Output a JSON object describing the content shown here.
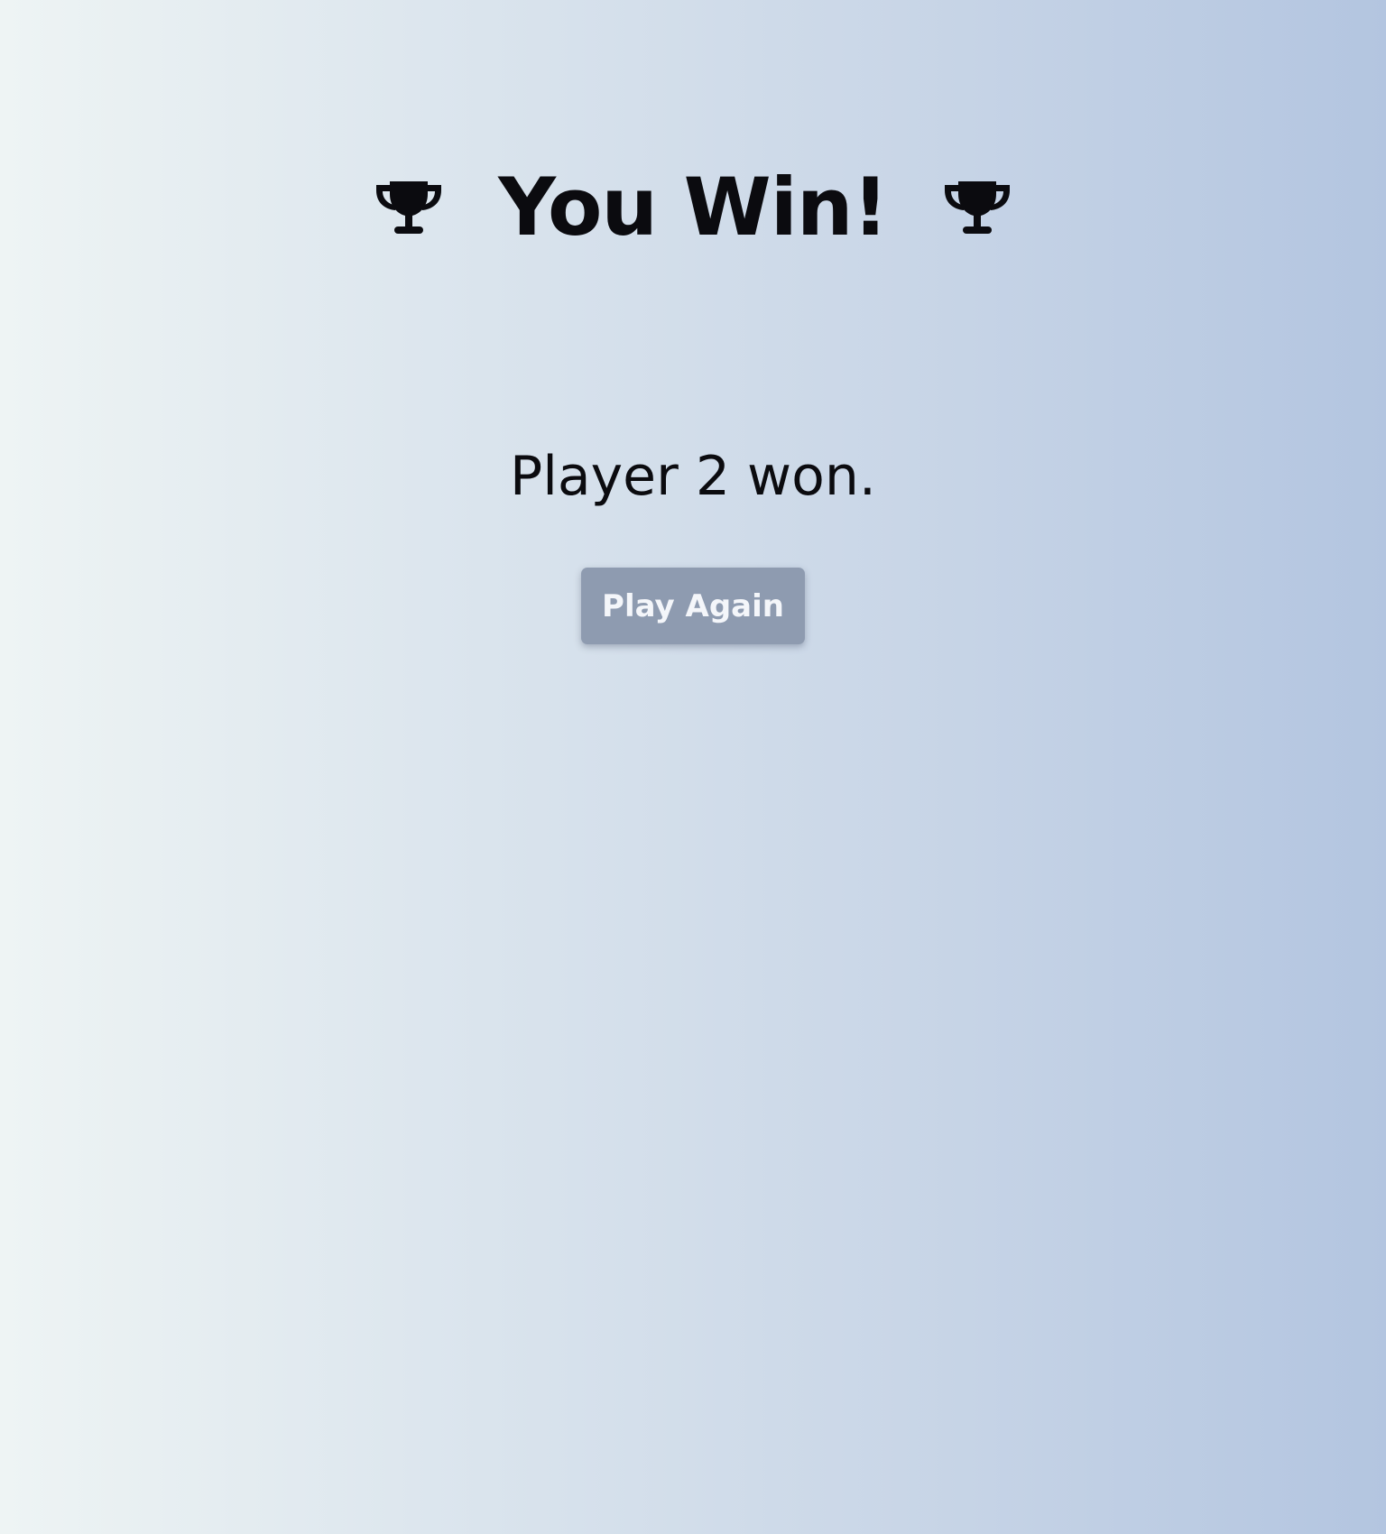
{
  "win_screen": {
    "title": "You Win!",
    "icons": {
      "left": "trophy-icon",
      "right": "trophy-icon"
    },
    "result_message": "Player 2 won.",
    "play_again_label": "Play Again"
  },
  "colors": {
    "background_gradient_start": "#eef4f4",
    "background_gradient_end": "#b3c5e0",
    "text": "#0b0b0f",
    "button_background": "#8e9bb0",
    "button_text": "#f4f6fa"
  }
}
